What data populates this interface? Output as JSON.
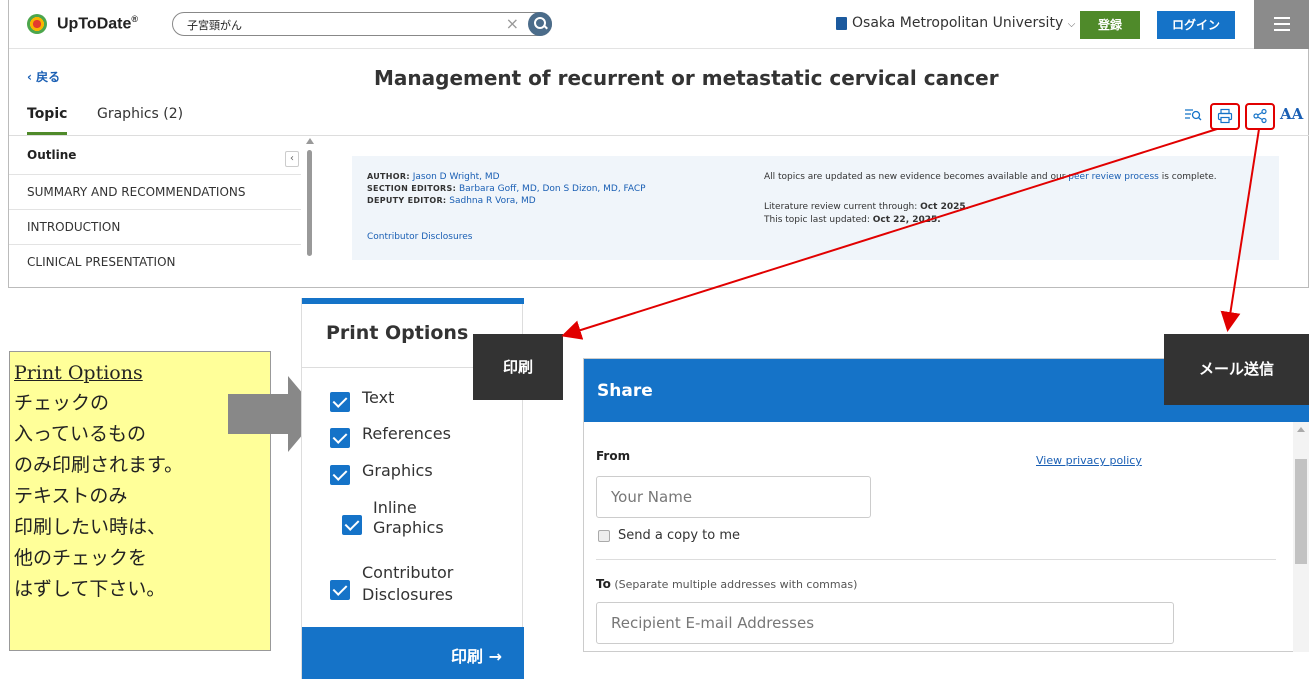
{
  "app": {
    "brand": "UpToDate",
    "brand_mark": "®",
    "search_value": "子宮頸がん",
    "institution": "Osaka Metropolitan University",
    "register_label": "登録",
    "login_label": "ログイン"
  },
  "topic": {
    "back_label": "戻る",
    "title": "Management of recurrent or metastatic cervical cancer",
    "tabs": [
      {
        "label": "Topic",
        "active": true
      },
      {
        "label": "Graphics (2)",
        "active": false
      }
    ],
    "outline_heading": "Outline",
    "outline_items": [
      "SUMMARY AND RECOMMENDATIONS",
      "INTRODUCTION",
      "CLINICAL PRESENTATION"
    ],
    "author_label": "AUTHOR:",
    "author": "Jason D Wright, MD",
    "section_editors_label": "SECTION EDITORS:",
    "section_editors": "Barbara Goff, MD, Don S Dizon, MD, FACP",
    "deputy_editor_label": "DEPUTY EDITOR:",
    "deputy_editor": "Sadhna R Vora, MD",
    "contributor_disclosures": "Contributor Disclosures",
    "update_note_pre": "All topics are updated as new evidence becomes available and our",
    "peer_review_link": "peer review process",
    "update_note_post": "is complete.",
    "lit_review_label": "Literature review current through:",
    "lit_review_date": "Oct 2025.",
    "last_updated_label": "This topic last updated:",
    "last_updated_date": "Oct 22, 2025."
  },
  "tools": {
    "find_icon": "search-in-page-icon",
    "print_icon": "printer-icon",
    "share_icon": "share-icon",
    "font_size_label": "AA"
  },
  "annotation": {
    "title": "Print Options",
    "lines": [
      "チェックの",
      "入っているもの",
      "のみ印刷されます。",
      "テキストのみ",
      "印刷したい時は、",
      "他のチェックを",
      "はずして下さい。"
    ],
    "print_callout": "印刷",
    "share_callout": "メール送信"
  },
  "print_options": {
    "title": "Print Options",
    "options": [
      {
        "label": "Text",
        "checked": true
      },
      {
        "label": "References",
        "checked": true
      },
      {
        "label": "Graphics",
        "checked": true
      },
      {
        "label": "Inline Graphics",
        "label_line1": "Inline",
        "label_line2": "Graphics",
        "checked": true
      },
      {
        "label": "Contributor Disclosures",
        "label_line1": "Contributor",
        "label_line2": "Disclosures",
        "checked": true
      }
    ],
    "print_button": "印刷",
    "print_button_arrow": "→"
  },
  "share": {
    "title": "Share",
    "from_label": "From",
    "privacy_link": "View privacy policy",
    "name_placeholder": "Your Name",
    "copy_label": "Send a copy to me",
    "copy_checked": false,
    "to_label": "To",
    "to_hint": "(Separate multiple addresses with commas)",
    "recipient_placeholder": "Recipient E-mail Addresses"
  },
  "colors": {
    "primary_blue": "#1573c8",
    "register_green": "#4f8a2a",
    "highlight_red": "#e10000",
    "annotation_yellow": "#ffff99"
  }
}
